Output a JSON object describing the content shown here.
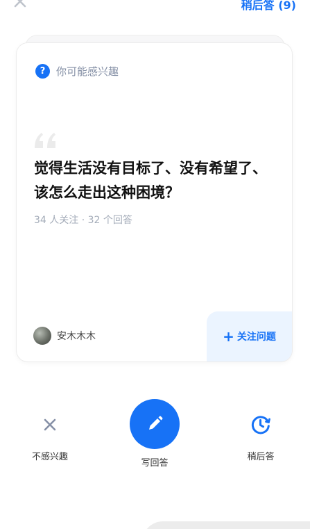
{
  "header": {
    "close_icon": "close-icon",
    "later_link": "稍后答 (9)"
  },
  "card": {
    "section_label": "你可能感兴趣",
    "section_icon": "question-icon",
    "question_title": "觉得生活没有目标了、没有希望了、该怎么走出这种困境？",
    "meta": "34 人关注 · 32 个回答",
    "author_name": "安木木木",
    "follow_button": "关注问题",
    "follow_icon": "plus-icon"
  },
  "actions": {
    "dislike_label": "不感兴趣",
    "answer_label": "写回答",
    "later_label": "稍后答"
  },
  "colors": {
    "brand": "#1772f6",
    "follow_bg": "#ebf4ff",
    "muted_text": "#a3abb8"
  }
}
